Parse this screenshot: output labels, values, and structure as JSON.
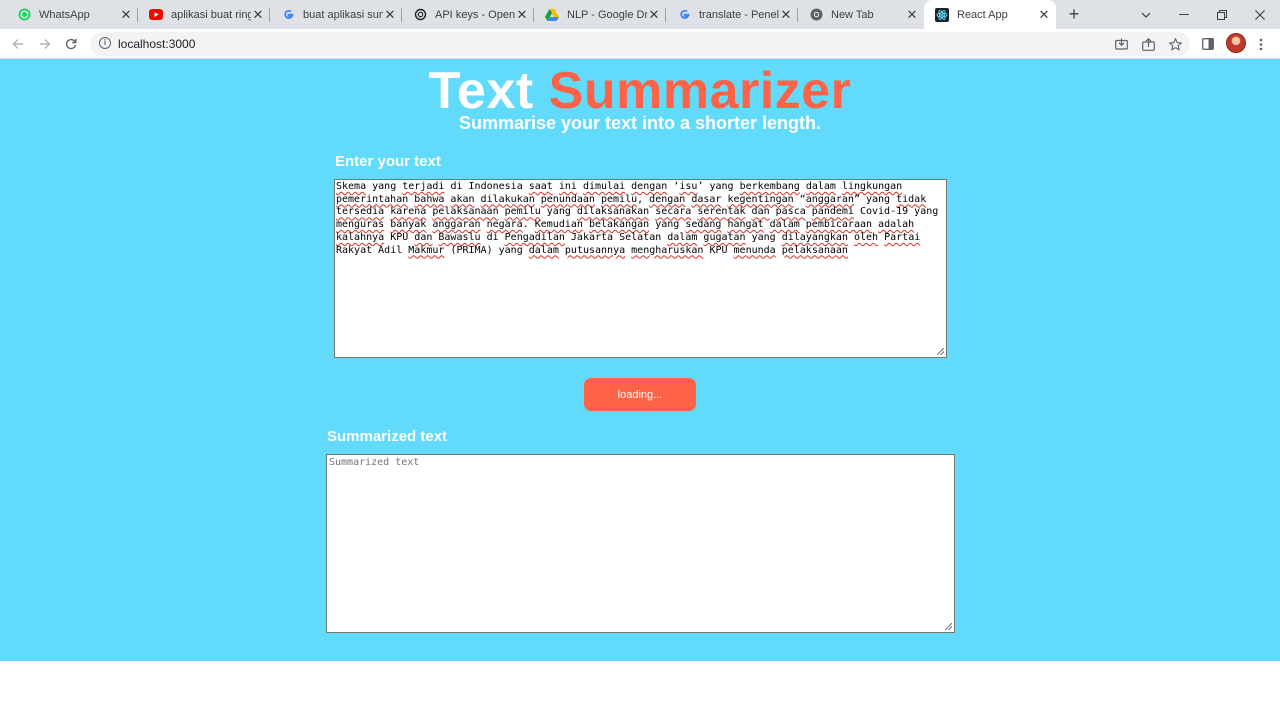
{
  "browser": {
    "tabs": [
      {
        "title": "WhatsApp",
        "icon": "whatsapp-icon"
      },
      {
        "title": "aplikasi buat ringkasan",
        "icon": "youtube-icon"
      },
      {
        "title": "buat aplikasi summarizer",
        "icon": "google-icon"
      },
      {
        "title": "API keys - OpenAI",
        "icon": "openai-icon"
      },
      {
        "title": "NLP - Google Drive",
        "icon": "google-drive-icon"
      },
      {
        "title": "translate - Penelusuran",
        "icon": "google-icon"
      },
      {
        "title": "New Tab",
        "icon": "chrome-icon"
      },
      {
        "title": "React App",
        "icon": "react-icon",
        "active": true
      }
    ],
    "url": "localhost:3000",
    "close_glyph": "✕",
    "new_tab_glyph": "+"
  },
  "app": {
    "title_white": "Text",
    "title_orange": "Summarizer",
    "subtitle": "Summarise your text into a shorter length.",
    "input_label": "Enter your text",
    "input_text": "Skema yang terjadi di Indonesia saat ini dimulai dengan ‘isu’ yang berkembang dalam lingkungan pemerintahan bahwa akan dilakukan penundaan pemilu, dengan dasar kegentingan “anggaran” yang tidak tersedia karena pelaksanaan pemilu yang dilaksanakan secara serentak dan pasca pandemi Covid-19 yang menguras banyak anggaran negara. Kemudian belakangan yang sedang hangat dalam pembicaraan adalah kalahnya KPU dan Bawaslu di Pengadilan Jakarta Selatan dalam gugatan yang dilayangkan oleh Partai Rakyat Adil Makmur (PRIMA) yang dalam putusannya mengharuskan KPU menunda pelaksanaan",
    "button_label": "loading...",
    "output_label": "Summarized text",
    "output_placeholder": "Summarized text"
  },
  "colors": {
    "page_bg": "#61dafb",
    "accent": "#ff6347",
    "heading_white": "#ffffff"
  }
}
